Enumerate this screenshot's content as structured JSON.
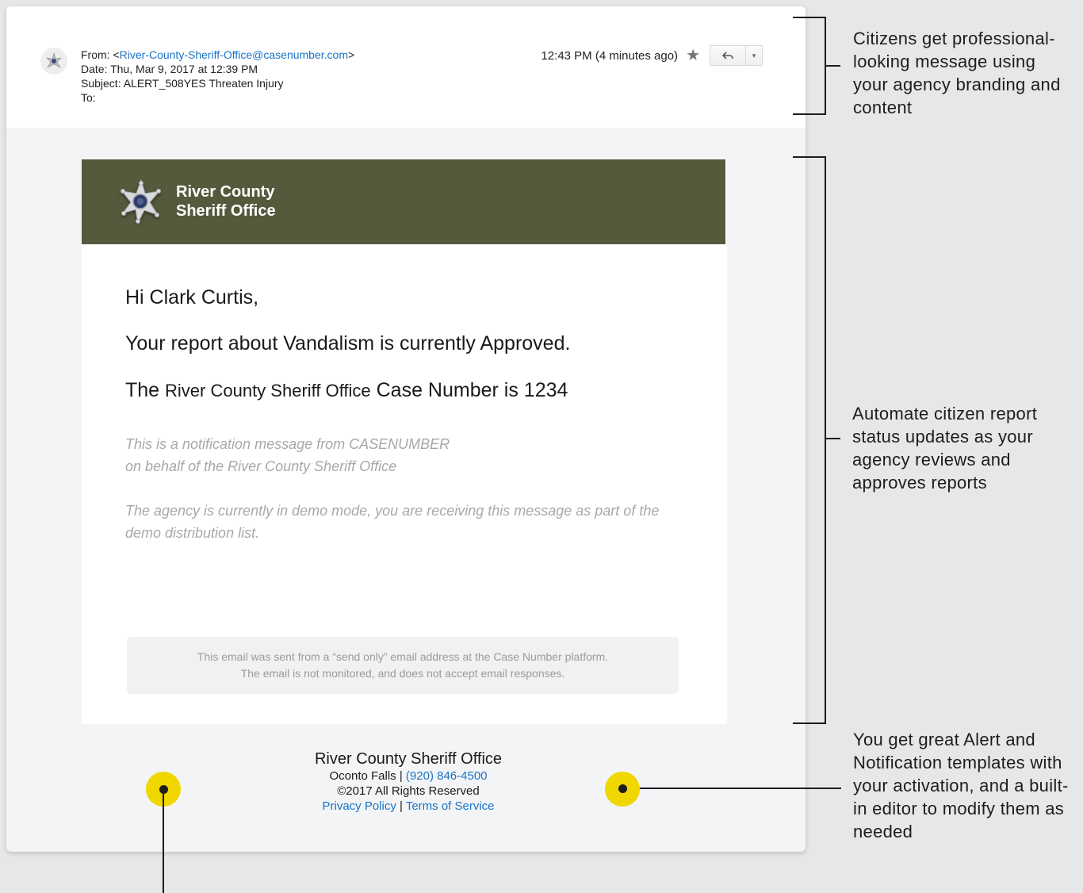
{
  "email_header": {
    "from_prefix": "From: <",
    "from_address": "River-County-Sheriff-Office@casenumber.com",
    "from_suffix": ">",
    "date": "Date: Thu, Mar 9, 2017 at 12:39 PM",
    "subject": "Subject: ALERT_508YES Threaten Injury",
    "to": "To:",
    "time": "12:43 PM (4 minutes ago)",
    "star_icon": "star-icon",
    "reply_icon": "reply-arrow-icon",
    "more_icon": "caret-down-icon"
  },
  "banner": {
    "line1": "River County",
    "line2": "Sheriff Office",
    "logo_icon": "sheriff-star-badge-icon",
    "color": "#555a3d"
  },
  "body": {
    "greeting": "Hi Clark Curtis,",
    "status": "Your report about Vandalism is currently Approved.",
    "case_prefix": "The ",
    "case_agency": "River County Sheriff Office",
    "case_suffix": " Case Number is 1234",
    "notice1_line1": "This is a notification message from CASENUMBER",
    "notice1_line2": "on behalf of the River County Sheriff Office",
    "notice2": "The agency is currently in demo mode, you are receiving this message as part of the demo distribution list.",
    "send_only_line1": "This email was sent from a “send only” email address at the Case Number platform.",
    "send_only_line2": "The email is not monitored, and does not accept email responses."
  },
  "footer": {
    "name": "River County Sheriff Office",
    "city": "Oconto Falls | ",
    "phone": "(920) 846-4500",
    "copyright": "©2017 All Rights Reserved",
    "privacy": "Privacy Policy",
    "separator": " | ",
    "terms": "Terms of Service"
  },
  "annotations": {
    "branding": "Citizens get professional-looking message using your agency branding and content",
    "automation": "Automate citizen report status updates as your agency reviews and approves reports",
    "templates": "You get great Alert and Notification templates with your activation, and a built-in editor to modify them as needed"
  },
  "colors": {
    "link": "#1a73c8",
    "highlight_dot": "#f1d700"
  }
}
